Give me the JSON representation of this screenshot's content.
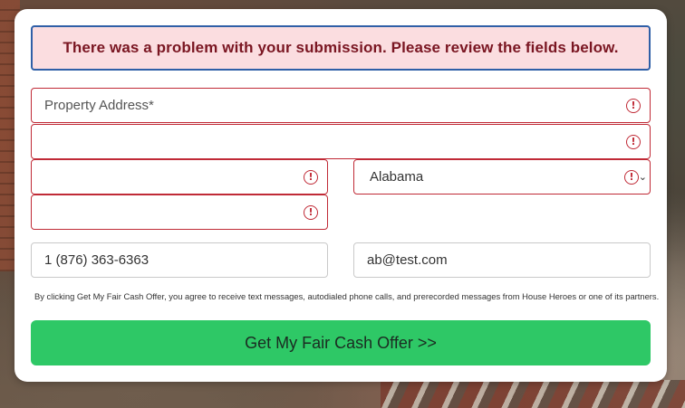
{
  "form": {
    "error_banner": "There was a problem with your submission. Please review the fields below.",
    "address_placeholder": "Property Address*",
    "address_line2_value": "",
    "city_value": "",
    "state_selected": "Alabama",
    "zip_value": "",
    "phone_value": "1 (876) 363-6363",
    "email_value": "ab@test.com",
    "consent_text": "By clicking Get My Fair Cash Offer, you agree to receive text messages, autodialed phone calls, and prerecorded messages from House Heroes or one of its partners.",
    "submit_label": "Get My Fair Cash Offer >>",
    "error_icon_glyph": "!",
    "chevron_glyph": "⌄"
  },
  "colors": {
    "error_border": "#c02a36",
    "error_bg": "#fbdde0",
    "banner_border": "#2f5fa7",
    "submit_bg": "#2ec866"
  }
}
